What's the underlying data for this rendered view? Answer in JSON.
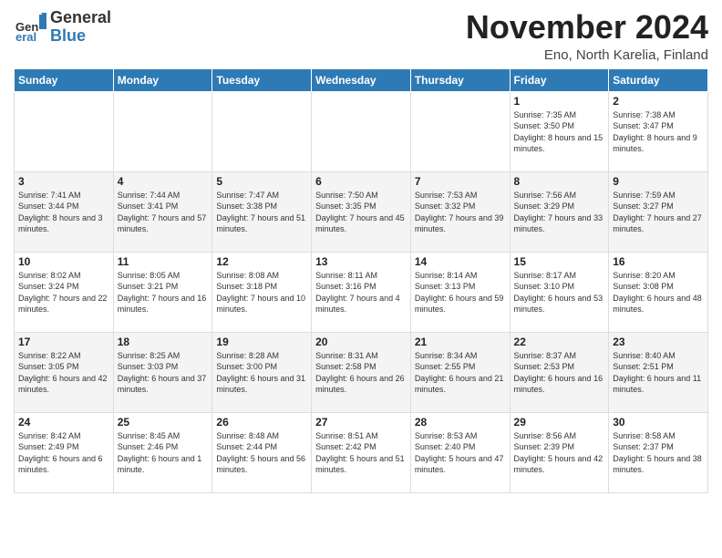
{
  "logo": {
    "general": "General",
    "blue": "Blue"
  },
  "title": "November 2024",
  "location": "Eno, North Karelia, Finland",
  "days_of_week": [
    "Sunday",
    "Monday",
    "Tuesday",
    "Wednesday",
    "Thursday",
    "Friday",
    "Saturday"
  ],
  "weeks": [
    [
      {
        "day": "",
        "info": ""
      },
      {
        "day": "",
        "info": ""
      },
      {
        "day": "",
        "info": ""
      },
      {
        "day": "",
        "info": ""
      },
      {
        "day": "",
        "info": ""
      },
      {
        "day": "1",
        "info": "Sunrise: 7:35 AM\nSunset: 3:50 PM\nDaylight: 8 hours\nand 15 minutes."
      },
      {
        "day": "2",
        "info": "Sunrise: 7:38 AM\nSunset: 3:47 PM\nDaylight: 8 hours\nand 9 minutes."
      }
    ],
    [
      {
        "day": "3",
        "info": "Sunrise: 7:41 AM\nSunset: 3:44 PM\nDaylight: 8 hours\nand 3 minutes."
      },
      {
        "day": "4",
        "info": "Sunrise: 7:44 AM\nSunset: 3:41 PM\nDaylight: 7 hours\nand 57 minutes."
      },
      {
        "day": "5",
        "info": "Sunrise: 7:47 AM\nSunset: 3:38 PM\nDaylight: 7 hours\nand 51 minutes."
      },
      {
        "day": "6",
        "info": "Sunrise: 7:50 AM\nSunset: 3:35 PM\nDaylight: 7 hours\nand 45 minutes."
      },
      {
        "day": "7",
        "info": "Sunrise: 7:53 AM\nSunset: 3:32 PM\nDaylight: 7 hours\nand 39 minutes."
      },
      {
        "day": "8",
        "info": "Sunrise: 7:56 AM\nSunset: 3:29 PM\nDaylight: 7 hours\nand 33 minutes."
      },
      {
        "day": "9",
        "info": "Sunrise: 7:59 AM\nSunset: 3:27 PM\nDaylight: 7 hours\nand 27 minutes."
      }
    ],
    [
      {
        "day": "10",
        "info": "Sunrise: 8:02 AM\nSunset: 3:24 PM\nDaylight: 7 hours\nand 22 minutes."
      },
      {
        "day": "11",
        "info": "Sunrise: 8:05 AM\nSunset: 3:21 PM\nDaylight: 7 hours\nand 16 minutes."
      },
      {
        "day": "12",
        "info": "Sunrise: 8:08 AM\nSunset: 3:18 PM\nDaylight: 7 hours\nand 10 minutes."
      },
      {
        "day": "13",
        "info": "Sunrise: 8:11 AM\nSunset: 3:16 PM\nDaylight: 7 hours\nand 4 minutes."
      },
      {
        "day": "14",
        "info": "Sunrise: 8:14 AM\nSunset: 3:13 PM\nDaylight: 6 hours\nand 59 minutes."
      },
      {
        "day": "15",
        "info": "Sunrise: 8:17 AM\nSunset: 3:10 PM\nDaylight: 6 hours\nand 53 minutes."
      },
      {
        "day": "16",
        "info": "Sunrise: 8:20 AM\nSunset: 3:08 PM\nDaylight: 6 hours\nand 48 minutes."
      }
    ],
    [
      {
        "day": "17",
        "info": "Sunrise: 8:22 AM\nSunset: 3:05 PM\nDaylight: 6 hours\nand 42 minutes."
      },
      {
        "day": "18",
        "info": "Sunrise: 8:25 AM\nSunset: 3:03 PM\nDaylight: 6 hours\nand 37 minutes."
      },
      {
        "day": "19",
        "info": "Sunrise: 8:28 AM\nSunset: 3:00 PM\nDaylight: 6 hours\nand 31 minutes."
      },
      {
        "day": "20",
        "info": "Sunrise: 8:31 AM\nSunset: 2:58 PM\nDaylight: 6 hours\nand 26 minutes."
      },
      {
        "day": "21",
        "info": "Sunrise: 8:34 AM\nSunset: 2:55 PM\nDaylight: 6 hours\nand 21 minutes."
      },
      {
        "day": "22",
        "info": "Sunrise: 8:37 AM\nSunset: 2:53 PM\nDaylight: 6 hours\nand 16 minutes."
      },
      {
        "day": "23",
        "info": "Sunrise: 8:40 AM\nSunset: 2:51 PM\nDaylight: 6 hours\nand 11 minutes."
      }
    ],
    [
      {
        "day": "24",
        "info": "Sunrise: 8:42 AM\nSunset: 2:49 PM\nDaylight: 6 hours\nand 6 minutes."
      },
      {
        "day": "25",
        "info": "Sunrise: 8:45 AM\nSunset: 2:46 PM\nDaylight: 6 hours\nand 1 minute."
      },
      {
        "day": "26",
        "info": "Sunrise: 8:48 AM\nSunset: 2:44 PM\nDaylight: 5 hours\nand 56 minutes."
      },
      {
        "day": "27",
        "info": "Sunrise: 8:51 AM\nSunset: 2:42 PM\nDaylight: 5 hours\nand 51 minutes."
      },
      {
        "day": "28",
        "info": "Sunrise: 8:53 AM\nSunset: 2:40 PM\nDaylight: 5 hours\nand 47 minutes."
      },
      {
        "day": "29",
        "info": "Sunrise: 8:56 AM\nSunset: 2:39 PM\nDaylight: 5 hours\nand 42 minutes."
      },
      {
        "day": "30",
        "info": "Sunrise: 8:58 AM\nSunset: 2:37 PM\nDaylight: 5 hours\nand 38 minutes."
      }
    ]
  ]
}
